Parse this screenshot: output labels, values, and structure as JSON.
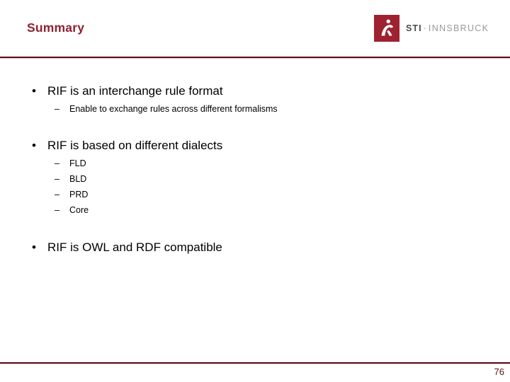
{
  "slide": {
    "title": "Summary",
    "page_number": "76",
    "accent_color": "#8c2233",
    "rule_color": "#5e0f1b",
    "rule_highlight_color": "#e8c9cf",
    "logo": {
      "mark_color": "#9e2230",
      "mark_icon": "sti-figure-icon",
      "name_bold": "STI",
      "separator": "·",
      "name_light": "INNSBRUCK"
    },
    "bullets": [
      {
        "marker": "•",
        "text": "RIF is an interchange rule format",
        "sub": [
          {
            "marker": "–",
            "text": "Enable to exchange rules across different formalisms"
          }
        ]
      },
      {
        "marker": "•",
        "text": "RIF is based on different dialects",
        "sub": [
          {
            "marker": "–",
            "text": "FLD"
          },
          {
            "marker": "–",
            "text": "BLD"
          },
          {
            "marker": "–",
            "text": "PRD"
          },
          {
            "marker": "–",
            "text": "Core"
          }
        ]
      },
      {
        "marker": "•",
        "text": "RIF is OWL and RDF compatible",
        "sub": []
      }
    ]
  }
}
